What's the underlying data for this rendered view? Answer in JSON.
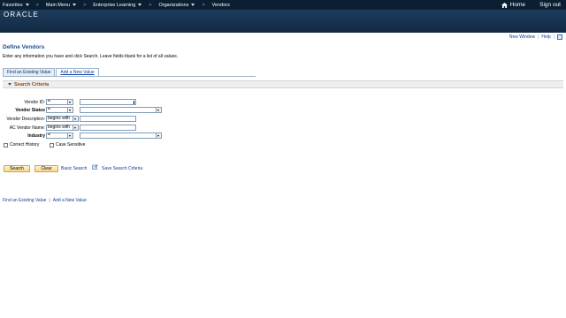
{
  "nav": {
    "items": [
      {
        "label": "Favorites"
      },
      {
        "label": "Main Menu"
      },
      {
        "label": "Enterprise Learning"
      },
      {
        "label": "Organizations"
      },
      {
        "label": "Vendors"
      }
    ],
    "separator": ">",
    "home_label": "Home",
    "signout_label": "Sign out"
  },
  "brand": {
    "logo_text": "ORACLE"
  },
  "util": {
    "new_window": "New Window",
    "help": "Help",
    "sep": "|"
  },
  "page": {
    "title": "Define Vendors",
    "instructions": "Enter any information you have and click Search. Leave fields blank for a list of all values."
  },
  "tabs": [
    {
      "label": "Find an Existing Value"
    },
    {
      "label": "Add a New Value"
    }
  ],
  "criteria": {
    "header": "Search Criteria",
    "fields": [
      {
        "label": "Vendor ID:",
        "operator": "=",
        "value": ""
      },
      {
        "label": "Vendor Status",
        "operator": "=",
        "value": ""
      },
      {
        "label": "Vendor Description:",
        "operator": "begins with",
        "value": ""
      },
      {
        "label": "AC Vendor Name:",
        "operator": "begins with",
        "value": ""
      },
      {
        "label": "Industry",
        "operator": "=",
        "value": ""
      }
    ],
    "correct_history": "Correct History",
    "case_sensitive": "Case Sensitive"
  },
  "actions": {
    "search": "Search",
    "clear": "Clear",
    "basic_search": "Basic Search",
    "save_criteria": "Save Search Criteria"
  },
  "bottom": {
    "find_existing": "Find an Existing Value",
    "add_new": "Add a New Value",
    "sep": "|"
  },
  "colors": {
    "nav_bg": "#0b1f33",
    "brand_bg": "#16324f",
    "title": "#1c4f8c",
    "section_label": "#8a4a12",
    "link": "#0b3e9e"
  }
}
